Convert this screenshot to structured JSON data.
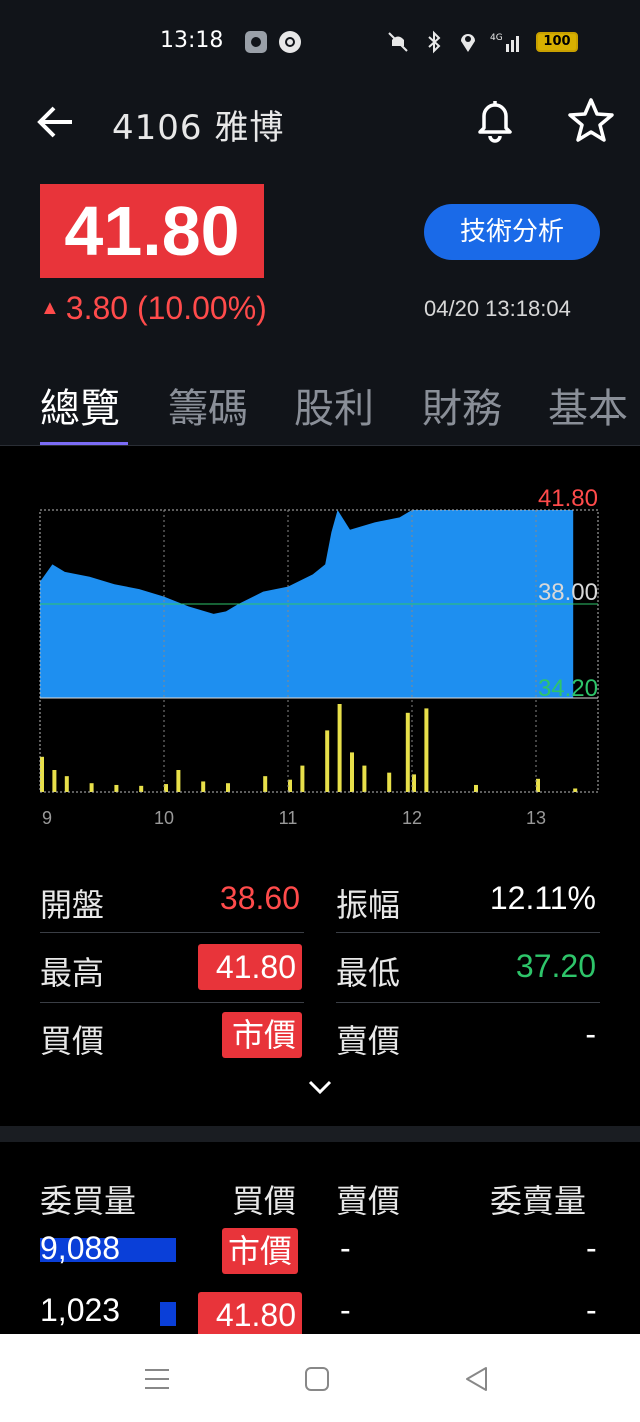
{
  "status_bar": {
    "time": "13:18",
    "battery": "100",
    "icons": [
      "settings-icon",
      "chrome-icon",
      "mute-icon",
      "bluetooth-icon",
      "location-icon",
      "signal-4g-icon",
      "battery-icon"
    ]
  },
  "header": {
    "title": "4106 雅博",
    "price": "41.80",
    "change": "3.80 (10.00%)",
    "timestamp": "04/20 13:18:04",
    "tech_button": "技術分析",
    "accent_color": "#e8343a",
    "button_color": "#1a6ae8"
  },
  "tabs": [
    "總覽",
    "籌碼",
    "股利",
    "財務",
    "基本"
  ],
  "chart_data": {
    "type": "area",
    "title": "",
    "x_ticks": [
      "9",
      "10",
      "11",
      "12",
      "13"
    ],
    "y_labels": {
      "high": "41.80",
      "ref": "38.00",
      "low": "34.20"
    },
    "ylim": [
      34.2,
      41.8
    ],
    "reference": 38.0,
    "price_x": [
      9.0,
      9.1,
      9.2,
      9.4,
      9.6,
      9.8,
      10.0,
      10.2,
      10.4,
      10.5,
      10.6,
      10.8,
      11.0,
      11.2,
      11.3,
      11.35,
      11.4,
      11.5,
      11.7,
      11.9,
      12.0,
      12.5,
      13.0,
      13.3
    ],
    "price_y": [
      38.9,
      39.6,
      39.3,
      39.1,
      38.8,
      38.6,
      38.3,
      37.9,
      37.6,
      37.7,
      38.0,
      38.5,
      38.7,
      39.2,
      39.6,
      40.9,
      41.8,
      41.0,
      41.3,
      41.5,
      41.8,
      41.8,
      41.8,
      41.8
    ],
    "volume_x": [
      9.0,
      9.1,
      9.2,
      9.4,
      9.6,
      9.8,
      10.0,
      10.1,
      10.3,
      10.5,
      10.8,
      11.0,
      11.1,
      11.3,
      11.4,
      11.5,
      11.6,
      11.8,
      11.95,
      12.0,
      12.1,
      12.5,
      13.0,
      13.3
    ],
    "volume": [
      40,
      25,
      18,
      10,
      8,
      7,
      9,
      25,
      12,
      10,
      18,
      14,
      30,
      70,
      100,
      45,
      30,
      22,
      90,
      20,
      95,
      8,
      15,
      4
    ],
    "volume_color": "#e8e04a",
    "area_color": "#1e8ff0"
  },
  "stats": {
    "open_label": "開盤",
    "open": "38.60",
    "amplitude_label": "振幅",
    "amplitude": "12.11%",
    "high_label": "最高",
    "high": "41.80",
    "low_label": "最低",
    "low": "37.20",
    "bid_label": "買價",
    "bid": "市價",
    "ask_label": "賣價",
    "ask": "-"
  },
  "order_book": {
    "headers": [
      "委買量",
      "買價",
      "賣價",
      "委賣量"
    ],
    "rows": [
      {
        "bid_qty": "9,088",
        "bid_price": "市價",
        "ask_price": "-",
        "ask_qty": "-",
        "bid_qty_fraction": 1.0
      },
      {
        "bid_qty": "1,023",
        "bid_price": "41.80",
        "ask_price": "-",
        "ask_qty": "-",
        "bid_qty_fraction": 0.11
      }
    ]
  }
}
